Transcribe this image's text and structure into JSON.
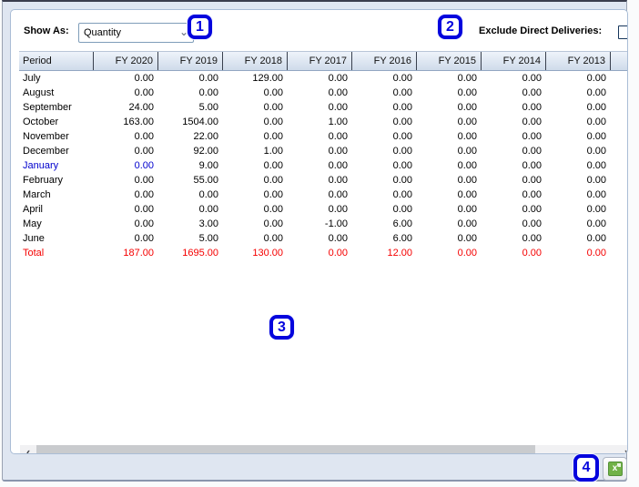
{
  "toolbar": {
    "show_as_label": "Show As:",
    "show_as_value": "Quantity",
    "exclude_label": "Exclude Direct Deliveries:",
    "exclude_checked": false
  },
  "annotations": [
    "1",
    "2",
    "3",
    "4"
  ],
  "table": {
    "period_header": "Period",
    "columns": [
      "FY 2020",
      "FY 2019",
      "FY 2018",
      "FY 2017",
      "FY 2016",
      "FY 2015",
      "FY 2014",
      "FY 2013"
    ],
    "rows": [
      {
        "label": "July",
        "values": [
          "0.00",
          "0.00",
          "129.00",
          "0.00",
          "0.00",
          "0.00",
          "0.00",
          "0.00"
        ]
      },
      {
        "label": "August",
        "values": [
          "0.00",
          "0.00",
          "0.00",
          "0.00",
          "0.00",
          "0.00",
          "0.00",
          "0.00"
        ]
      },
      {
        "label": "September",
        "values": [
          "24.00",
          "5.00",
          "0.00",
          "0.00",
          "0.00",
          "0.00",
          "0.00",
          "0.00"
        ]
      },
      {
        "label": "October",
        "values": [
          "163.00",
          "1504.00",
          "0.00",
          "1.00",
          "0.00",
          "0.00",
          "0.00",
          "0.00"
        ]
      },
      {
        "label": "November",
        "values": [
          "0.00",
          "22.00",
          "0.00",
          "0.00",
          "0.00",
          "0.00",
          "0.00",
          "0.00"
        ]
      },
      {
        "label": "December",
        "values": [
          "0.00",
          "92.00",
          "1.00",
          "0.00",
          "0.00",
          "0.00",
          "0.00",
          "0.00"
        ]
      },
      {
        "label": "January",
        "values": [
          "0.00",
          "9.00",
          "0.00",
          "0.00",
          "0.00",
          "0.00",
          "0.00",
          "0.00"
        ],
        "label_color": "#0000cd",
        "cell_colors": {
          "0": "#0000cd"
        }
      },
      {
        "label": "February",
        "values": [
          "0.00",
          "55.00",
          "0.00",
          "0.00",
          "0.00",
          "0.00",
          "0.00",
          "0.00"
        ]
      },
      {
        "label": "March",
        "values": [
          "0.00",
          "0.00",
          "0.00",
          "0.00",
          "0.00",
          "0.00",
          "0.00",
          "0.00"
        ]
      },
      {
        "label": "April",
        "values": [
          "0.00",
          "0.00",
          "0.00",
          "0.00",
          "0.00",
          "0.00",
          "0.00",
          "0.00"
        ]
      },
      {
        "label": "May",
        "values": [
          "0.00",
          "3.00",
          "0.00",
          "-1.00",
          "6.00",
          "0.00",
          "0.00",
          "0.00"
        ]
      },
      {
        "label": "June",
        "values": [
          "0.00",
          "5.00",
          "0.00",
          "0.00",
          "6.00",
          "0.00",
          "0.00",
          "0.00"
        ]
      },
      {
        "label": "Total",
        "values": [
          "187.00",
          "1695.00",
          "130.00",
          "0.00",
          "12.00",
          "0.00",
          "0.00",
          "0.00"
        ],
        "row_color": "#f50000"
      }
    ]
  },
  "scrollbar": {
    "left_arrow": "‹",
    "right_arrow": "›"
  },
  "export": {
    "excel_glyph": "x"
  },
  "dropdown_chevron": "⌄",
  "colors": {
    "annotation_blue": "#0404dd",
    "total_red": "#f50000",
    "january_blue": "#0000cd",
    "excel_green": "#71b247"
  }
}
